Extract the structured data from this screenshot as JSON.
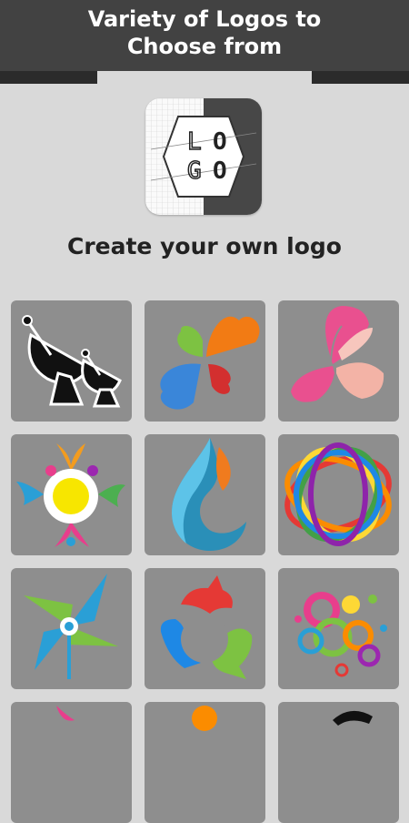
{
  "banner": {
    "line1": "Variety of Logos to",
    "line2": "Choose from"
  },
  "app_icon": {
    "letters": [
      "L",
      "O",
      "G",
      "O"
    ]
  },
  "heading": "Create your own logo",
  "logos": [
    {
      "name": "satellite-dish"
    },
    {
      "name": "hearts-clover"
    },
    {
      "name": "butterfly"
    },
    {
      "name": "flower"
    },
    {
      "name": "flame-drop"
    },
    {
      "name": "rainbow-rings"
    },
    {
      "name": "pinwheel"
    },
    {
      "name": "animal-circle"
    },
    {
      "name": "color-circles"
    }
  ]
}
